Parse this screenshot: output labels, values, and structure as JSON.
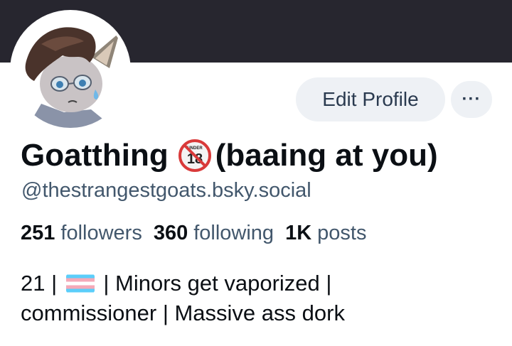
{
  "profile": {
    "display_name_prefix": "Goatthing",
    "display_name_suffix": "(baaing at you)",
    "under18_badge_text": "UNDER",
    "under18_badge_number": "18",
    "handle": "@thestrangestgoats.bsky.social",
    "edit_button_label": "Edit Profile",
    "more_button_label": "···",
    "stats": [
      {
        "value": "251",
        "label": "followers"
      },
      {
        "value": "360",
        "label": "following"
      },
      {
        "value": "1K",
        "label": "posts"
      }
    ],
    "bio": {
      "line1_prefix": "21 | ",
      "line1_suffix": " | Minors get vaporized |",
      "line2": "commissioner | Massive ass dork"
    }
  },
  "colors": {
    "banner": "#27262f",
    "button_bg": "#eef1f5",
    "secondary_text": "#42576c",
    "primary_text": "#0b0f14"
  },
  "icons": {
    "avatar": "goat-avatar",
    "badge": "no-under-18-icon",
    "flag": "transgender-flag-icon",
    "more": "ellipsis-icon"
  }
}
